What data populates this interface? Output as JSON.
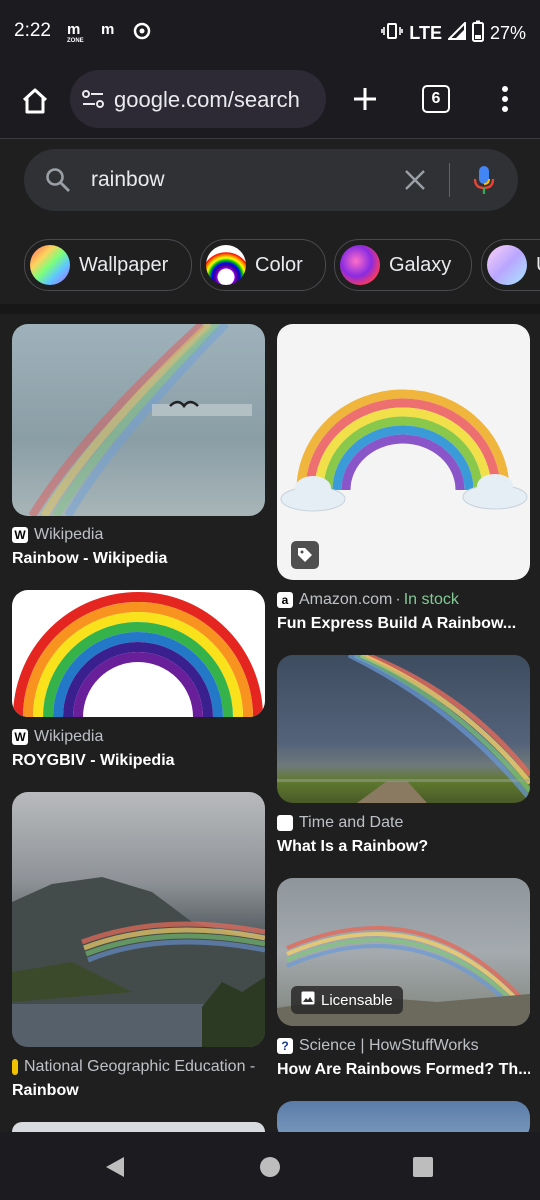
{
  "status": {
    "time": "2:22",
    "network": "LTE",
    "battery": "27%"
  },
  "toolbar": {
    "url": "google.com/search",
    "tab_count": "6"
  },
  "search": {
    "query": "rainbow"
  },
  "chips": [
    {
      "label": "Wallpaper"
    },
    {
      "label": "Color"
    },
    {
      "label": "Galaxy"
    },
    {
      "label": "U"
    }
  ],
  "results": {
    "r1": {
      "source": "Wikipedia",
      "title": "Rainbow - Wikipedia"
    },
    "r2": {
      "source": "Amazon.com",
      "stock": "In stock",
      "title": "Fun Express Build A Rainbow..."
    },
    "r3": {
      "source": "Wikipedia",
      "title": "ROYGBIV - Wikipedia"
    },
    "r4": {
      "source": "Time and Date",
      "title": "What Is a Rainbow?"
    },
    "r5": {
      "source": "National Geographic Education -",
      "title": "Rainbow"
    },
    "r6": {
      "source": "Science | HowStuffWorks",
      "title": "How Are Rainbows Formed? Th...",
      "badge": "Licensable"
    }
  },
  "icons": [
    "home-icon",
    "site-settings-icon",
    "new-tab-icon",
    "tab-switcher-icon",
    "menu-icon",
    "search-icon",
    "clear-icon",
    "mic-icon",
    "shopping-tag-icon",
    "image-icon",
    "back-icon",
    "home-nav-icon",
    "recents-icon"
  ],
  "colors": {
    "accent_green": "#81c995",
    "background": "#1f1f1f",
    "search_bg": "#303134"
  }
}
